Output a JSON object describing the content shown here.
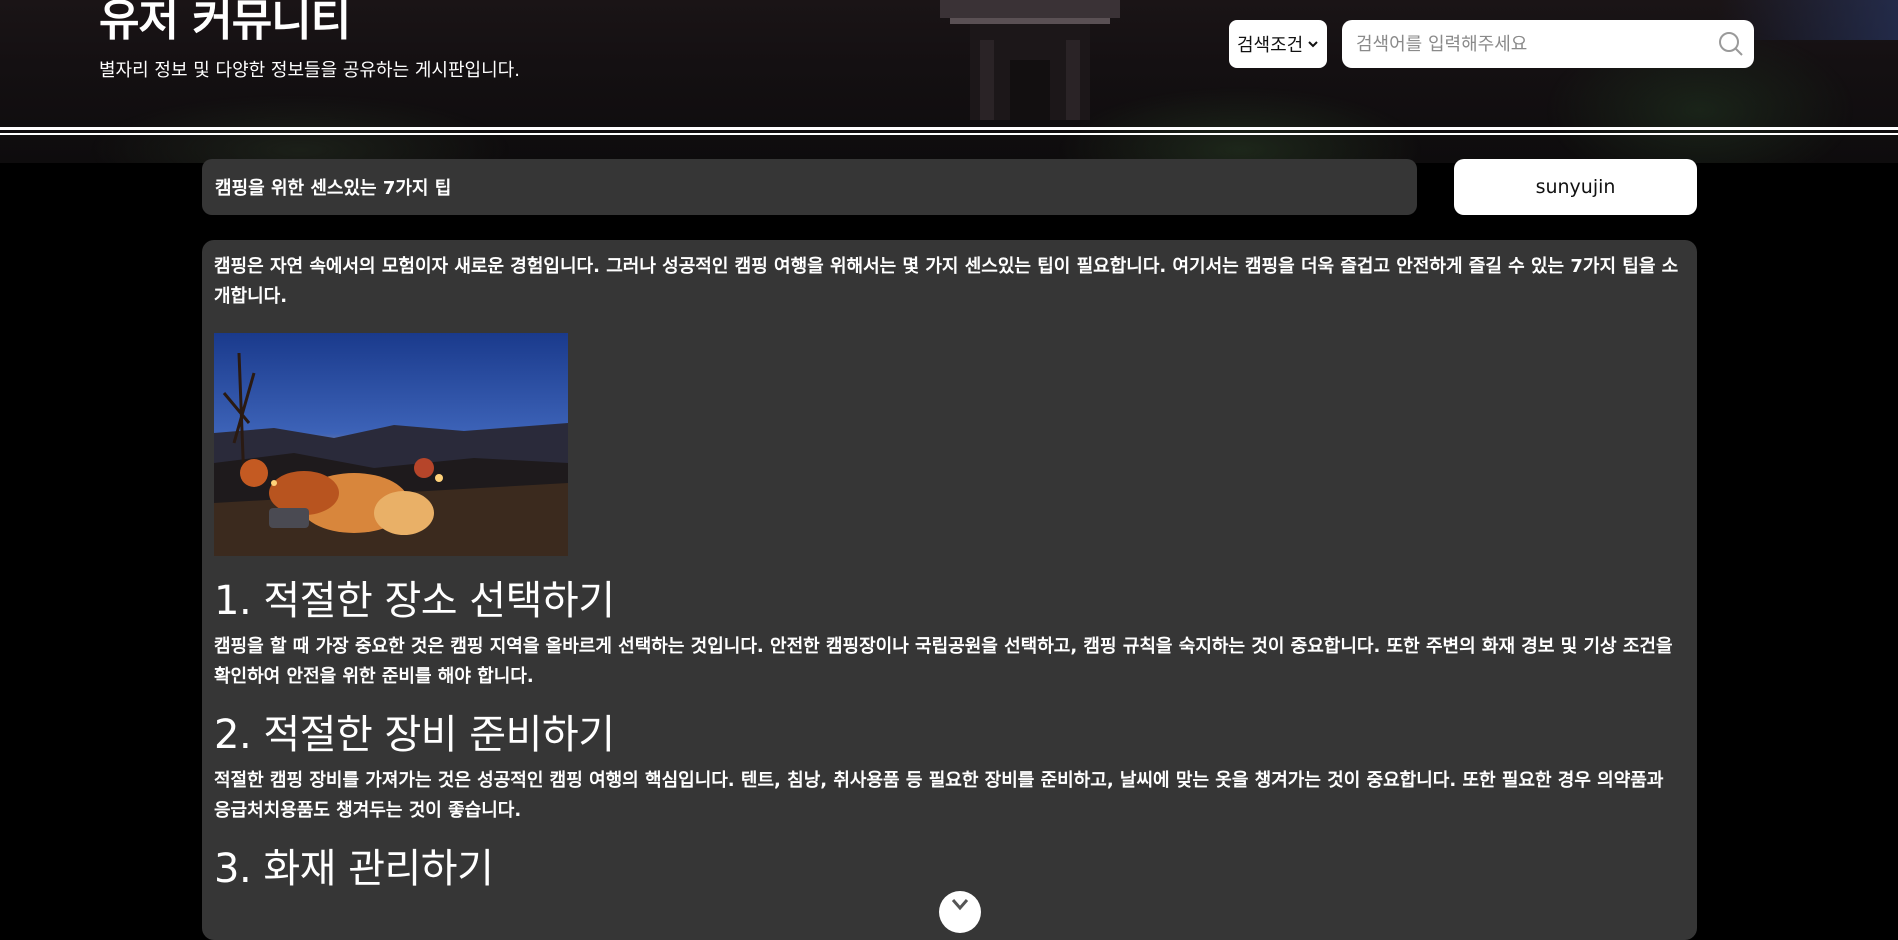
{
  "header": {
    "title": "유저 커뮤니티",
    "subtitle": "별자리 정보 및 다양한 정보들을 공유하는 게시판입니다."
  },
  "search": {
    "condition_label": "검색조건",
    "placeholder": "검색어를 입력해주세요",
    "value": "",
    "icon": "search-icon"
  },
  "post": {
    "title": "캠핑을 위한 센스있는 7가지 팁",
    "author": "sunyujin",
    "intro": "캠핑은 자연 속에서의 모험이자 새로운 경험입니다. 그러나 성공적인 캠핑 여행을 위해서는 몇 가지 센스있는 팁이 필요합니다. 여기서는 캠핑을 더욱 즐겁고 안전하게 즐길 수 있는 7가지 팁을 소개합니다.",
    "sections": [
      {
        "heading": "1. 적절한 장소 선택하기",
        "body": "캠핑을 할 때 가장 중요한 것은 캠핑 지역을 올바르게 선택하는 것입니다. 안전한 캠핑장이나 국립공원을 선택하고, 캠핑 규칙을 숙지하는 것이 중요합니다. 또한 주변의 화재 경보 및 기상 조건을 확인하여 안전을 위한 준비를 해야 합니다."
      },
      {
        "heading": "2. 적절한 장비 준비하기",
        "body": "적절한 캠핑 장비를 가져가는 것은 성공적인 캠핑 여행의 핵심입니다. 텐트, 침낭, 취사용품 등 필요한 장비를 준비하고, 날씨에 맞는 옷을 챙겨가는 것이 중요합니다. 또한 필요한 경우 의약품과 응급처치용품도 챙겨두는 것이 좋습니다."
      },
      {
        "heading": "3. 화재 관리하기",
        "body": ""
      }
    ]
  },
  "colors": {
    "page_bg": "#000000",
    "panel_bg": "#363636",
    "text": "#ffffff"
  },
  "scroll_button": {
    "icon": "chevron-down-icon"
  }
}
